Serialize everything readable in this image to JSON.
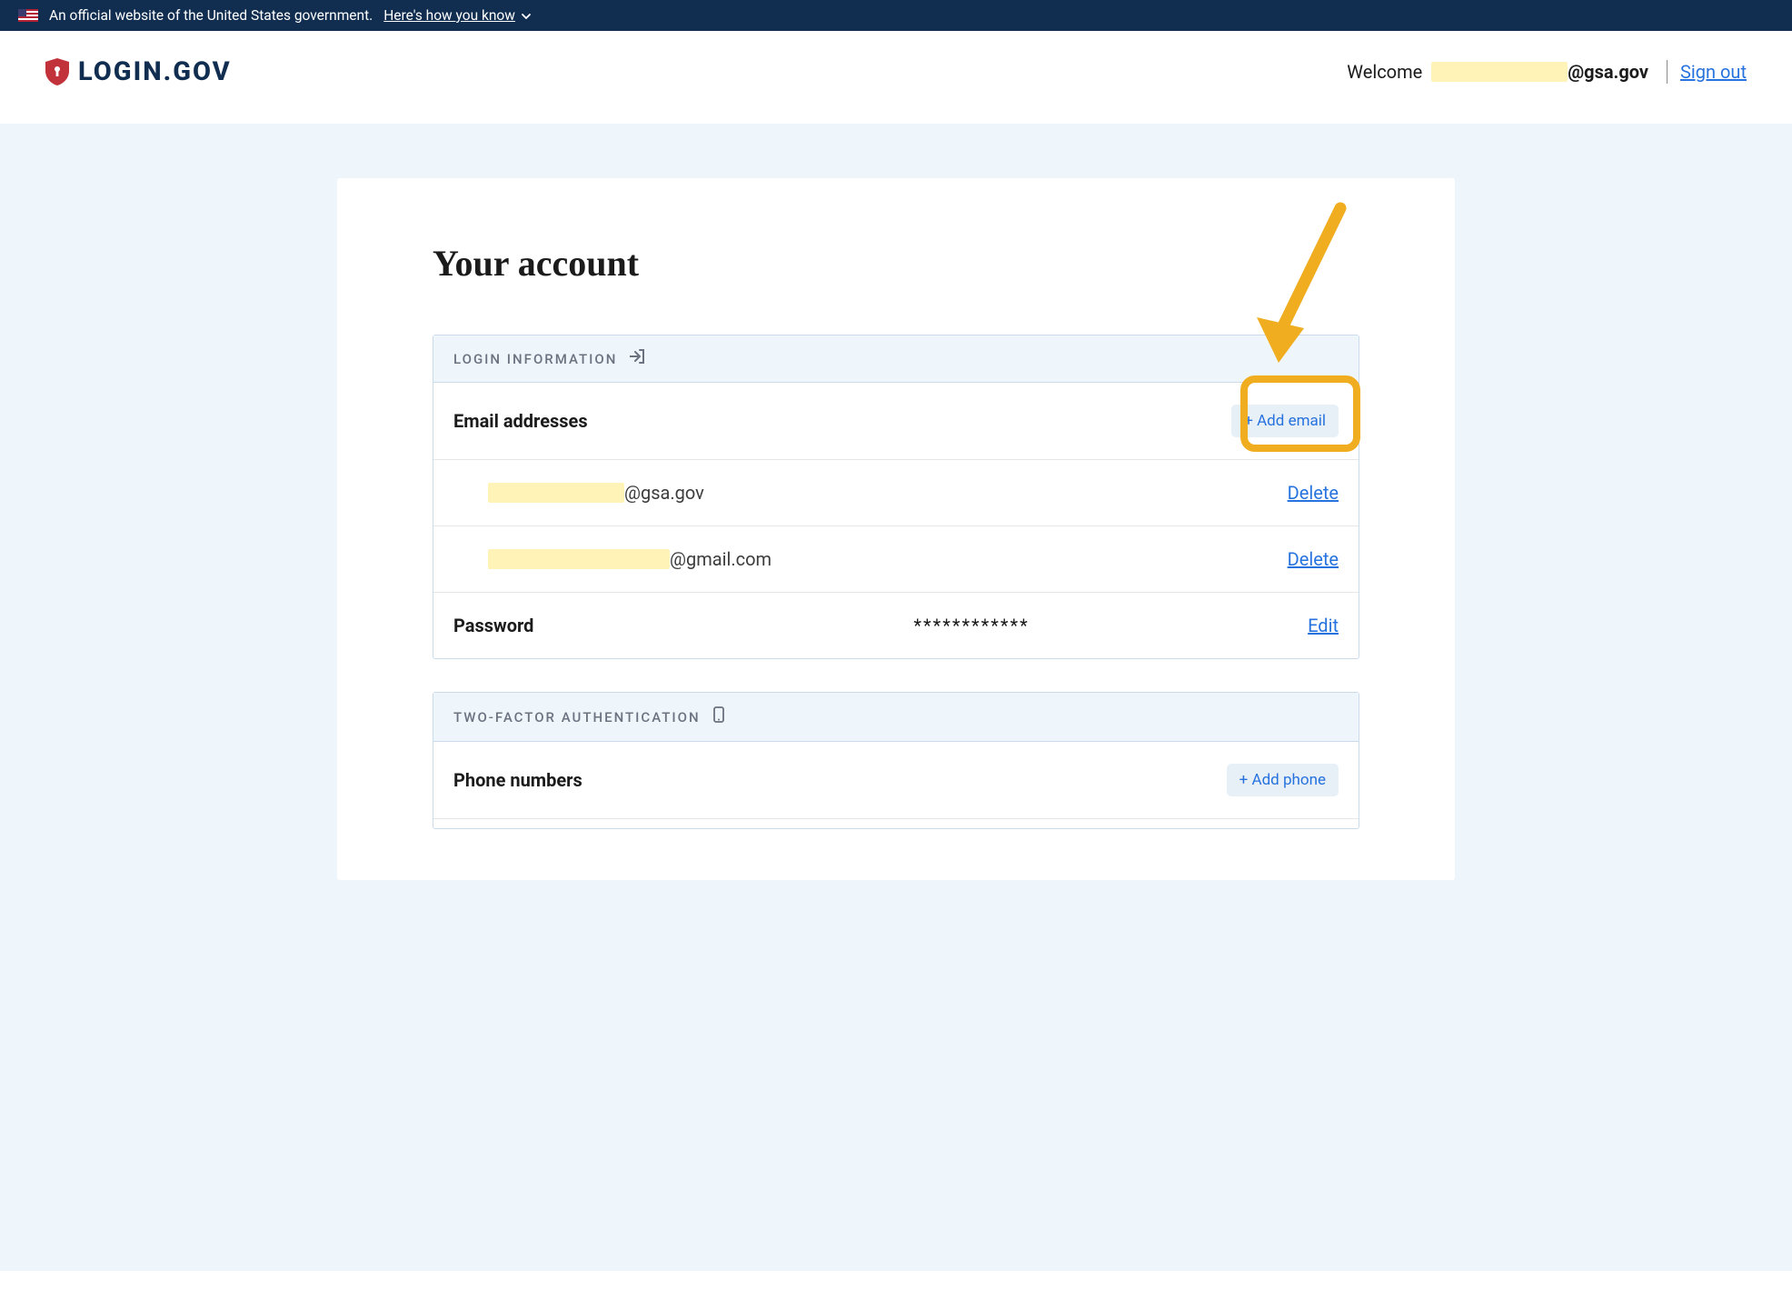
{
  "gov_banner": {
    "text": "An official website of the United States government.",
    "know_link": "Here's how you know"
  },
  "header": {
    "logo_text": "LOGIN.GOV",
    "welcome_prefix": "Welcome",
    "email_domain": "@gsa.gov",
    "sign_out": "Sign out"
  },
  "page": {
    "title": "Your account"
  },
  "login_info_panel": {
    "heading": "LOGIN INFORMATION",
    "email_section": {
      "label": "Email addresses",
      "add_button": "+ Add email",
      "emails": [
        {
          "domain": "@gsa.gov",
          "action": "Delete"
        },
        {
          "domain": "@gmail.com",
          "action": "Delete"
        }
      ]
    },
    "password_section": {
      "label": "Password",
      "masked": "************",
      "action": "Edit"
    }
  },
  "twofa_panel": {
    "heading": "TWO-FACTOR AUTHENTICATION",
    "phone_section": {
      "label": "Phone numbers",
      "add_button": "+ Add phone"
    }
  },
  "annotation": {
    "arrow_color": "#f0ad1f"
  }
}
